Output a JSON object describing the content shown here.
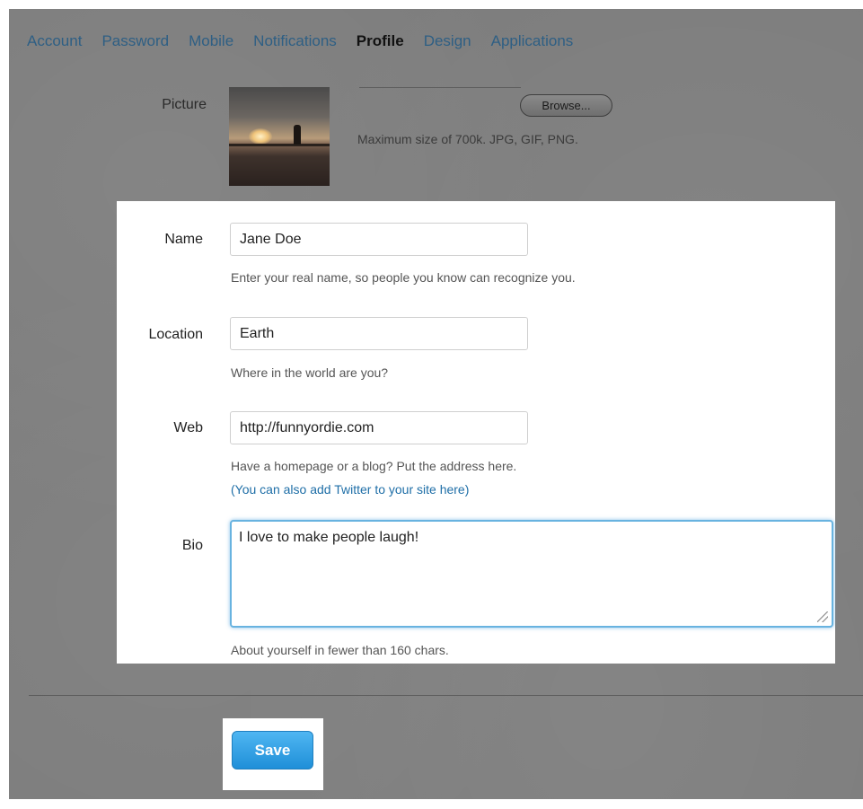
{
  "tabs": [
    {
      "label": "Account",
      "active": false
    },
    {
      "label": "Password",
      "active": false
    },
    {
      "label": "Mobile",
      "active": false
    },
    {
      "label": "Notifications",
      "active": false
    },
    {
      "label": "Profile",
      "active": true
    },
    {
      "label": "Design",
      "active": false
    },
    {
      "label": "Applications",
      "active": false
    }
  ],
  "picture": {
    "label": "Picture",
    "browse_label": "Browse...",
    "hint": "Maximum size of 700k. JPG, GIF, PNG."
  },
  "form": {
    "name": {
      "label": "Name",
      "value": "Jane Doe",
      "hint": "Enter your real name, so people you know can recognize you."
    },
    "location": {
      "label": "Location",
      "value": "Earth",
      "hint": "Where in the world are you?"
    },
    "web": {
      "label": "Web",
      "value": "http://funnyordie.com",
      "hint": "Have a homepage or a blog? Put the address here.",
      "link": "(You can also add Twitter to your site here)"
    },
    "bio": {
      "label": "Bio",
      "value": "I love to make people laugh!",
      "hint": "About yourself in fewer than 160 chars."
    }
  },
  "save_label": "Save",
  "colors": {
    "tab_link": "#2e5f84",
    "link": "#1e6ea7",
    "save_button": "#2a9be0",
    "focus_ring": "#68b3e0"
  }
}
